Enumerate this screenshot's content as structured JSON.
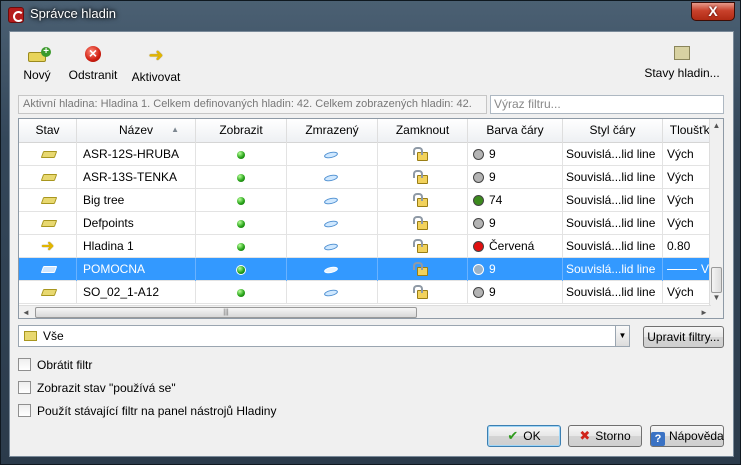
{
  "window": {
    "title": "Správce hladin",
    "close_label": "X"
  },
  "toolbar": {
    "new_label": "Nový",
    "delete_label": "Odstranit",
    "activate_label": "Aktivovat",
    "states_label": "Stavy hladin..."
  },
  "status_text": "Aktivní hladina: Hladina 1. Celkem definovaných hladin: 42. Celkem zobrazených hladin: 42.",
  "filter_input": {
    "placeholder": "Výraz filtru..."
  },
  "grid": {
    "columns": [
      "Stav",
      "Název",
      "Zobrazit",
      "Zmrazený",
      "Zamknout",
      "Barva čáry",
      "Styl čáry",
      "Tloušťka"
    ],
    "rows": [
      {
        "state": "folder-icon",
        "name": "ASR-12S-HRUBA",
        "color_label": "9",
        "color": "#b4b4b4",
        "linetype": "Souvislá...lid line",
        "lineweight": "Vých"
      },
      {
        "state": "folder-icon",
        "name": "ASR-13S-TENKA",
        "color_label": "9",
        "color": "#b4b4b4",
        "linetype": "Souvislá...lid line",
        "lineweight": "Vých"
      },
      {
        "state": "folder-icon",
        "name": "Big tree",
        "color_label": "74",
        "color": "#3c8a1e",
        "linetype": "Souvislá...lid line",
        "lineweight": "Vých"
      },
      {
        "state": "folder-icon",
        "name": "Defpoints",
        "color_label": "9",
        "color": "#b4b4b4",
        "linetype": "Souvislá...lid line",
        "lineweight": "Vých"
      },
      {
        "state": "arrow-icon",
        "name": "Hladina 1",
        "color_label": "Červená",
        "color": "#e01010",
        "linetype": "Souvislá...lid line",
        "lineweight": "0.80"
      },
      {
        "state": "folder-icon",
        "name": "POMOCNA",
        "color_label": "9",
        "color": "#9ab2c8",
        "linetype": "Souvislá...lid line",
        "lineweight": "Vých",
        "selected": true
      },
      {
        "state": "folder-icon",
        "name": "SO_02_1-A12",
        "color_label": "9",
        "color": "#b4b4b4",
        "linetype": "Souvislá...lid line",
        "lineweight": "Vých"
      }
    ]
  },
  "filter_select": {
    "value": "Vše"
  },
  "edit_filters_label": "Upravit filtry...",
  "checkboxes": {
    "invert": "Obrátit filtr",
    "show_in_use": "Zobrazit stav \"používá se\"",
    "apply_toolbar": "Použít stávající filtr na panel nástrojů Hladiny"
  },
  "buttons": {
    "ok": "OK",
    "cancel": "Storno",
    "help": "Nápověda"
  },
  "colors": {
    "selection": "#3399ff",
    "on_light": "#2aa51b"
  }
}
